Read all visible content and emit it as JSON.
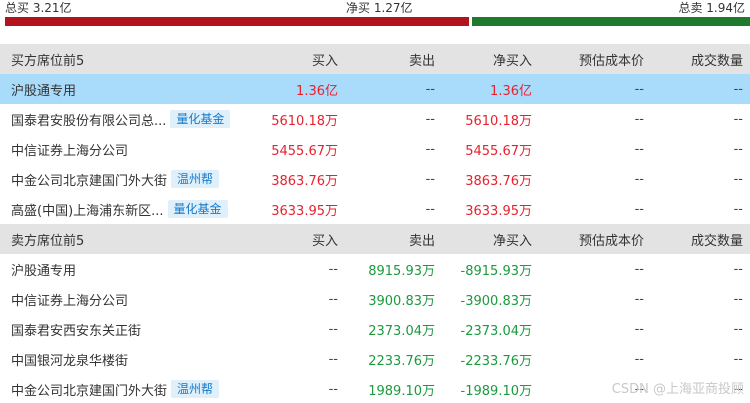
{
  "summary": {
    "buy_label": "总买 3.21亿",
    "net_label": "净买 1.27亿",
    "sell_label": "总卖 1.94亿",
    "buy_share": 0.623,
    "buy_color": "#b2131f",
    "sell_color": "#1f7a2e"
  },
  "buy_table": {
    "headers": [
      "买方席位前5",
      "买入",
      "卖出",
      "净买入",
      "预估成本价",
      "成交数量"
    ],
    "rows": [
      {
        "name": "沪股通专用",
        "tag": "",
        "buy": "1.36亿",
        "sell": "--",
        "net": "1.36亿",
        "cost": "--",
        "qty": "--"
      },
      {
        "name": "国泰君安股份有限公司总...",
        "tag": "量化基金",
        "buy": "5610.18万",
        "sell": "--",
        "net": "5610.18万",
        "cost": "--",
        "qty": "--"
      },
      {
        "name": "中信证券上海分公司",
        "tag": "",
        "buy": "5455.67万",
        "sell": "--",
        "net": "5455.67万",
        "cost": "--",
        "qty": "--"
      },
      {
        "name": "中金公司北京建国门外大街",
        "tag": "温州帮",
        "buy": "3863.76万",
        "sell": "--",
        "net": "3863.76万",
        "cost": "--",
        "qty": "--"
      },
      {
        "name": "高盛(中国)上海浦东新区...",
        "tag": "量化基金",
        "buy": "3633.95万",
        "sell": "--",
        "net": "3633.95万",
        "cost": "--",
        "qty": "--"
      }
    ]
  },
  "sell_table": {
    "headers": [
      "卖方席位前5",
      "买入",
      "卖出",
      "净买入",
      "预估成本价",
      "成交数量"
    ],
    "rows": [
      {
        "name": "沪股通专用",
        "tag": "",
        "buy": "--",
        "sell": "8915.93万",
        "net": "-8915.93万",
        "cost": "--",
        "qty": "--"
      },
      {
        "name": "中信证券上海分公司",
        "tag": "",
        "buy": "--",
        "sell": "3900.83万",
        "net": "-3900.83万",
        "cost": "--",
        "qty": "--"
      },
      {
        "name": "国泰君安西安东关正街",
        "tag": "",
        "buy": "--",
        "sell": "2373.04万",
        "net": "-2373.04万",
        "cost": "--",
        "qty": "--"
      },
      {
        "name": "中国银河龙泉华楼街",
        "tag": "",
        "buy": "--",
        "sell": "2233.76万",
        "net": "-2233.76万",
        "cost": "--",
        "qty": "--"
      },
      {
        "name": "中金公司北京建国门外大街",
        "tag": "温州帮",
        "buy": "--",
        "sell": "1989.10万",
        "net": "-1989.10万",
        "cost": "--",
        "qty": "--"
      }
    ]
  },
  "watermark": "CSDN @上海亚商投顾"
}
